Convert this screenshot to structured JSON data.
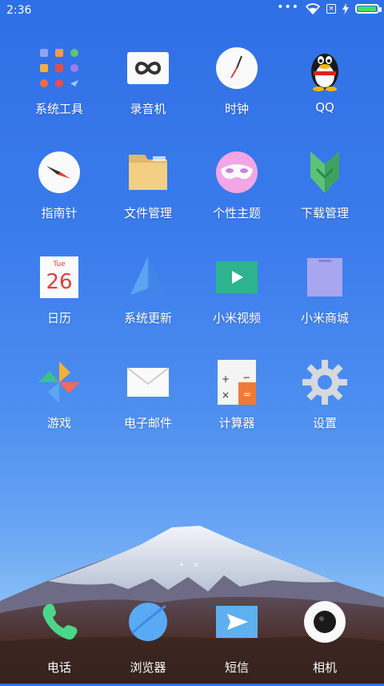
{
  "status_bar": {
    "time": "2:36",
    "dots": "•••",
    "battery_level": 0.95,
    "sim_icon": "sim-x-icon",
    "colors": {
      "battery_fill": "#4cd964"
    }
  },
  "apps": [
    {
      "label": "系统工具",
      "icon": "folder-tools-icon"
    },
    {
      "label": "录音机",
      "icon": "recorder-icon"
    },
    {
      "label": "时钟",
      "icon": "clock-icon"
    },
    {
      "label": "QQ",
      "icon": "qq-penguin-icon"
    },
    {
      "label": "指南针",
      "icon": "compass-icon"
    },
    {
      "label": "文件管理",
      "icon": "file-manager-icon"
    },
    {
      "label": "个性主题",
      "icon": "themes-mask-icon"
    },
    {
      "label": "下载管理",
      "icon": "download-manager-icon"
    },
    {
      "label": "日历",
      "icon": "calendar-icon",
      "calendar_day": "26",
      "calendar_weekday": "Tue"
    },
    {
      "label": "系统更新",
      "icon": "system-update-icon"
    },
    {
      "label": "小米视频",
      "icon": "video-play-icon"
    },
    {
      "label": "小米商城",
      "icon": "shop-bag-icon"
    },
    {
      "label": "游戏",
      "icon": "pinwheel-games-icon"
    },
    {
      "label": "电子邮件",
      "icon": "email-envelope-icon"
    },
    {
      "label": "计算器",
      "icon": "calculator-icon"
    },
    {
      "label": "设置",
      "icon": "gear-icon"
    }
  ],
  "dock": [
    {
      "label": "电话",
      "icon": "phone-icon"
    },
    {
      "label": "浏览器",
      "icon": "browser-icon"
    },
    {
      "label": "短信",
      "icon": "message-icon"
    },
    {
      "label": "相机",
      "icon": "camera-icon"
    }
  ],
  "page_indicator": "• ×"
}
